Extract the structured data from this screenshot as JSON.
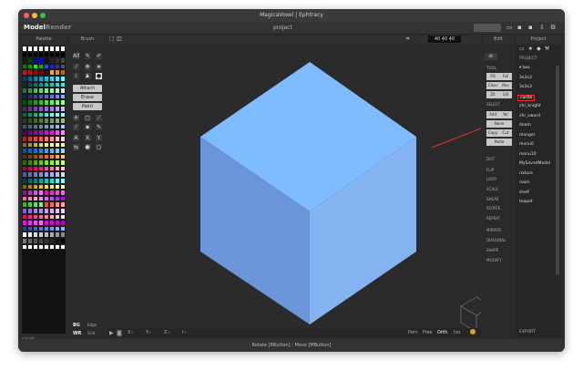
{
  "window": {
    "title": "MagicaVoxel | Ephtracy",
    "project_name": "project"
  },
  "modes": {
    "model": "Model",
    "render": "Render"
  },
  "panels": {
    "palette": "Palette",
    "brush": "Brush",
    "edit": "Edit",
    "project": "Project"
  },
  "brush": {
    "attach": "Attach",
    "erase": "Erase",
    "paint": "Paint",
    "all_label": "All"
  },
  "viewport": {
    "dims": "40  40  40",
    "coords": [
      "X:-",
      "Y:-",
      "Z:-",
      "I:-"
    ],
    "view_modes": [
      "Pers",
      "Free",
      "Orth",
      "Iso"
    ]
  },
  "edit": {
    "all": "All",
    "tool_section": "TOOL",
    "tool_buttons": [
      "Fill",
      "Full",
      "Clear",
      "Rev",
      "Zit",
      "1/0"
    ],
    "select_section": "SELECT",
    "select_buttons": [
      "Add",
      "Yer"
    ],
    "wide_buttons": [
      "None",
      "Copy",
      "Cut",
      "Paste"
    ],
    "sections": [
      "DIST",
      "FLIP",
      "LOOP",
      "SCALE",
      "SHEAR",
      "ROTATE",
      "REPEAT",
      "MIRROR",
      "DIAGONAL",
      "SHAPE",
      "MOCKFY"
    ]
  },
  "project": {
    "section": "PROJECT",
    "items": [
      "box",
      "3x3x3",
      "3x3x3",
      "castle",
      "chr_knight",
      "chr_sword",
      "doom",
      "monger",
      "monu0",
      "monu10",
      "MySavedModel",
      "nature",
      "room",
      "shelf",
      "teapot"
    ],
    "selected_index": 3,
    "export": "EXPORT"
  },
  "bottom_panels": {
    "bg": "BG",
    "wr": "WR",
    "dm": "DM",
    "edge": "Edge",
    "grid": "Grid",
    "frame": "Frame",
    "color": "COLOR"
  },
  "status": "Rotate [RButton] : Move [MButton]",
  "colors": {
    "cube_top": "#7fbcff",
    "cube_left": "#6a96d9",
    "cube_right": "#84b3f2",
    "selection": "#e5332a",
    "accent": "#d9a62a"
  },
  "palette_colors": [
    "#ffffff",
    "#ffffff",
    "#ffffff",
    "#ffffff",
    "#ffffff",
    "#ffffff",
    "#ffffff",
    "#ffffff",
    "#000000",
    "#000000",
    "#000000",
    "#000000",
    "#000000",
    "#000000",
    "#000000",
    "#000000",
    "#002200",
    "#004400",
    "#0000aa",
    "#0000ff",
    "#111111",
    "#222222",
    "#333333",
    "#444444",
    "#008000",
    "#00a000",
    "#00ff00",
    "#11aa11",
    "#1155ff",
    "#2222cc",
    "#333399",
    "#555555",
    "#ff0000",
    "#dd0000",
    "#aa0000",
    "#770000",
    "#440000",
    "#ffaa00",
    "#ff8800",
    "#cc6600",
    "#004466",
    "#006688",
    "#0088aa",
    "#00aacc",
    "#00ccee",
    "#22ddff",
    "#44eeff",
    "#66ffff",
    "#003322",
    "#005544",
    "#007766",
    "#009988",
    "#00bbaa",
    "#11ccbb",
    "#22ddcc",
    "#33eedd",
    "#227733",
    "#339944",
    "#44bb55",
    "#55dd66",
    "#66ff77",
    "#88ff99",
    "#aaffbb",
    "#ccffdd",
    "#112244",
    "#223366",
    "#334488",
    "#4455aa",
    "#5566cc",
    "#6677ee",
    "#7788ff",
    "#99aaff",
    "#005500",
    "#117711",
    "#229922",
    "#33bb33",
    "#44dd44",
    "#55ff55",
    "#77ff77",
    "#99ff99",
    "#552266",
    "#663388",
    "#7744aa",
    "#8855cc",
    "#9966ee",
    "#aa77ff",
    "#bb99ff",
    "#ccbbff",
    "#006655",
    "#118877",
    "#22aa99",
    "#33ccbb",
    "#44eedd",
    "#66ffee",
    "#88ffee",
    "#aaffff",
    "#224411",
    "#335522",
    "#446633",
    "#557744",
    "#668855",
    "#779966",
    "#88aa77",
    "#99bb88",
    "#335577",
    "#446688",
    "#557799",
    "#6688aa",
    "#7799bb",
    "#88aacc",
    "#99bbdd",
    "#aaccee",
    "#550055",
    "#770077",
    "#990099",
    "#bb00bb",
    "#dd00dd",
    "#ff00ff",
    "#ff44ff",
    "#ff88ff",
    "#aa2222",
    "#cc3333",
    "#ee4444",
    "#ff5555",
    "#ff7777",
    "#ff9999",
    "#ffbbbb",
    "#ffdddd",
    "#777722",
    "#999933",
    "#bbbb44",
    "#dddd55",
    "#ffff66",
    "#ffff88",
    "#ffffaa",
    "#ffffcc",
    "#0055aa",
    "#0066cc",
    "#0077ee",
    "#1188ff",
    "#33aaff",
    "#55bbff",
    "#77ccff",
    "#99ddff",
    "#553300",
    "#774400",
    "#995500",
    "#bb6600",
    "#dd7700",
    "#ff8800",
    "#ffaa33",
    "#ffcc66",
    "#336600",
    "#448800",
    "#55aa00",
    "#66cc00",
    "#77ee00",
    "#88ff11",
    "#aaff44",
    "#ccff77",
    "#aa0055",
    "#cc0066",
    "#ee0077",
    "#ff1188",
    "#ff44aa",
    "#ff77bb",
    "#ffaacc",
    "#ffccdd",
    "#5555aa",
    "#6666bb",
    "#7777cc",
    "#8888dd",
    "#9999ee",
    "#aaaaff",
    "#bbbbff",
    "#ddddff",
    "#004444",
    "#006666",
    "#008888",
    "#00aaaa",
    "#00cccc",
    "#00eeee",
    "#44ffff",
    "#88ffff",
    "#886600",
    "#aa8800",
    "#ccaa00",
    "#eecc00",
    "#ffdd22",
    "#ffee55",
    "#ffff88",
    "#ffffbb",
    "#aa00aa",
    "#cc22cc",
    "#ee44ee",
    "#ff66ff",
    "#ff00aa",
    "#ff22bb",
    "#ff44cc",
    "#ff66dd",
    "#ff66aa",
    "#ff88bb",
    "#ffaacc",
    "#ee88ff",
    "#dd66ff",
    "#cc44ff",
    "#bb22ff",
    "#aa00ff",
    "#22bb22",
    "#44cc44",
    "#66dd66",
    "#88ee88",
    "#ff4444",
    "#ff6666",
    "#ff8888",
    "#ffaaaa",
    "#8855ff",
    "#9966ff",
    "#aa77ff",
    "#bb88ff",
    "#cc99ff",
    "#ddaaff",
    "#eebbff",
    "#ffccff",
    "#ff0066",
    "#ff2277",
    "#ff4488",
    "#ff6699",
    "#ff88aa",
    "#ffaabb",
    "#ffcccc",
    "#ffeeee",
    "#ff00ff",
    "#ff22ff",
    "#ff44ff",
    "#ff66ff",
    "#ee00ee",
    "#dd00dd",
    "#cc00cc",
    "#bb00bb",
    "#2244aa",
    "#3355bb",
    "#4466cc",
    "#5577dd",
    "#6688ee",
    "#7799ff",
    "#88aaff",
    "#99bbff",
    "#ffffff",
    "#eeeeee",
    "#dddddd",
    "#cccccc",
    "#bbbbbb",
    "#aaaaaa",
    "#999999",
    "#888888",
    "#777777",
    "#666666",
    "#555555",
    "#444444",
    "#333333",
    "#222222",
    "#111111",
    "#000000",
    "#ffffff",
    "#ffffff",
    "#ffffff",
    "#ffffff",
    "#ffffff",
    "#ffffff",
    "#ffffff",
    "#ffffff"
  ]
}
